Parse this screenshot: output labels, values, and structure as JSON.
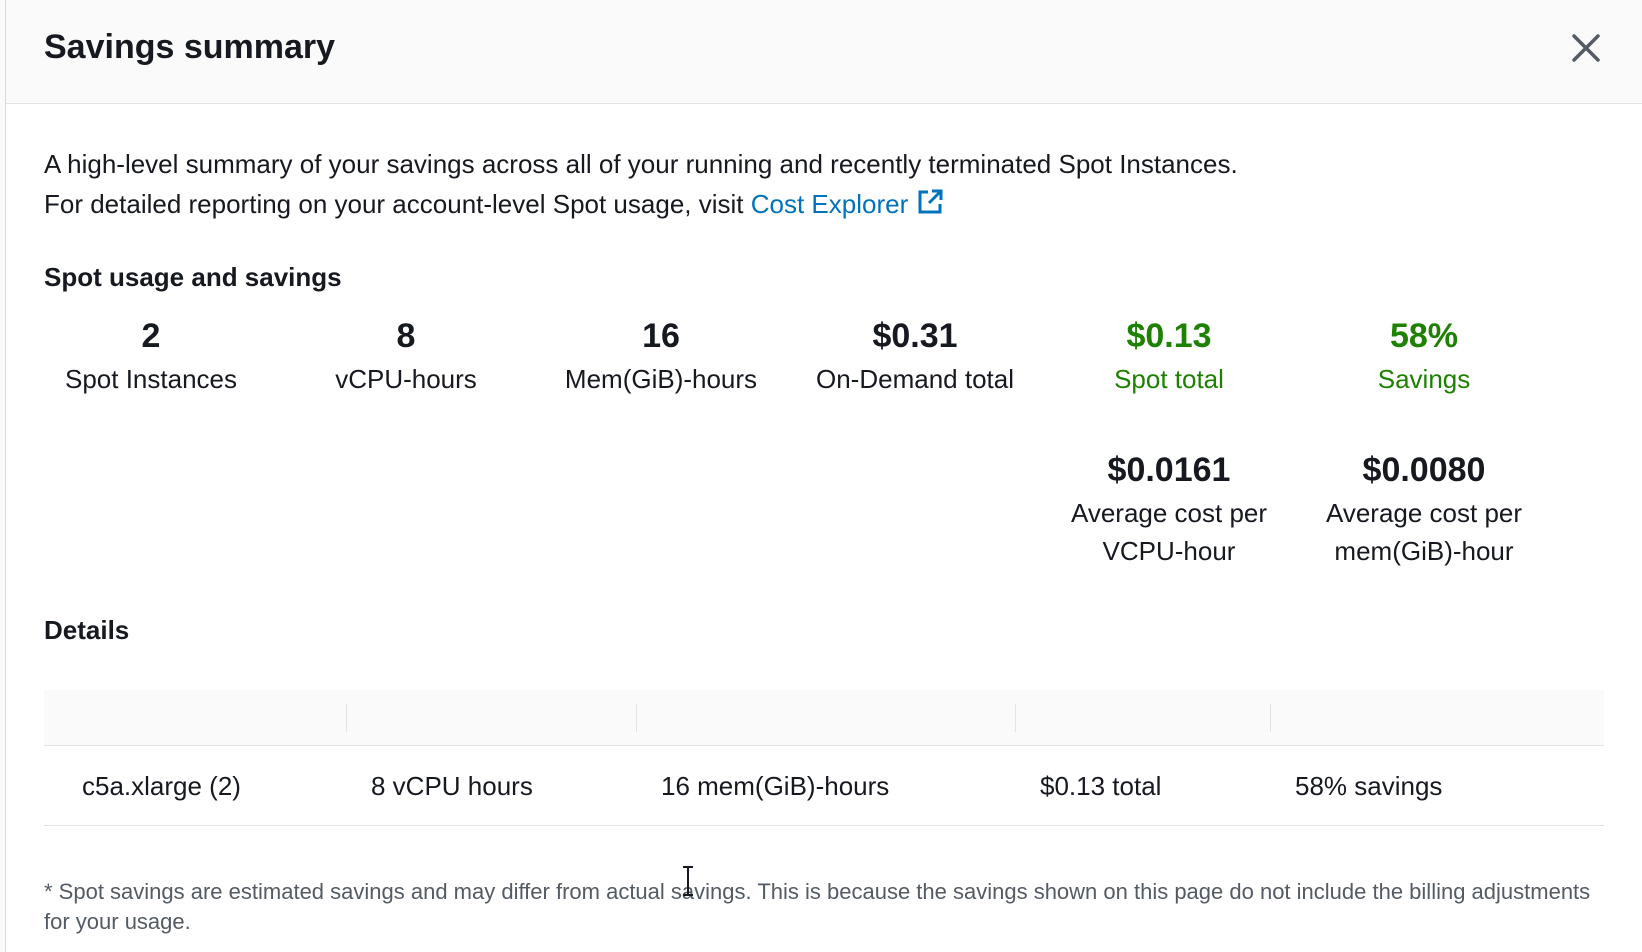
{
  "modal": {
    "title": "Savings summary",
    "close_icon": "close-icon"
  },
  "intro": {
    "line1": "A high-level summary of your savings across all of your running and recently terminated Spot Instances.",
    "line2_prefix": "For detailed reporting on your account-level Spot usage, visit ",
    "link_label": "Cost Explorer",
    "link_icon": "external-link-icon"
  },
  "usage": {
    "heading": "Spot usage and savings",
    "stats": [
      {
        "value": "2",
        "label": "Spot Instances"
      },
      {
        "value": "8",
        "label": "vCPU-hours"
      },
      {
        "value": "16",
        "label": "Mem(GiB)-hours"
      },
      {
        "value": "$0.31",
        "label": "On-Demand total"
      },
      {
        "value": "$0.13",
        "label": "Spot total"
      },
      {
        "value": "58%",
        "label": "Savings"
      }
    ],
    "averages": [
      {
        "value": "$0.0161",
        "label_line1": "Average cost per",
        "label_line2": "VCPU-hour"
      },
      {
        "value": "$0.0080",
        "label_line1": "Average cost per",
        "label_line2": "mem(GiB)-hour"
      }
    ]
  },
  "details": {
    "heading": "Details",
    "rows": [
      [
        "c5a.xlarge (2)",
        "8 vCPU hours",
        "16 mem(GiB)-hours",
        "$0.13 total",
        "58% savings"
      ]
    ]
  },
  "footnote": "* Spot savings are estimated savings and may differ from actual savings. This is because the savings shown on this page do not include the billing adjustments for your usage.",
  "colors": {
    "accent_link": "#0073bb",
    "savings_green": "#1d8102",
    "text": "#16191f",
    "muted": "#545b64"
  }
}
